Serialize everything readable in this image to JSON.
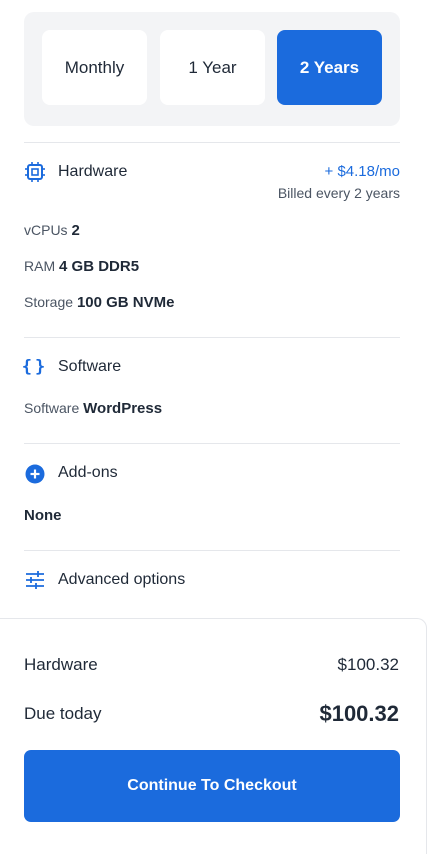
{
  "billing_period": {
    "options": [
      "Monthly",
      "1 Year",
      "2 Years"
    ],
    "selected": "2 Years"
  },
  "hardware": {
    "title": "Hardware",
    "price": "+ $4.18/mo",
    "billed": "Billed every 2 years",
    "specs": [
      {
        "label": "vCPUs",
        "value": "2"
      },
      {
        "label": "RAM",
        "value": "4 GB DDR5"
      },
      {
        "label": "Storage",
        "value": "100 GB NVMe"
      }
    ]
  },
  "software": {
    "title": "Software",
    "label": "Software",
    "value": "WordPress"
  },
  "addons": {
    "title": "Add-ons",
    "value": "None"
  },
  "advanced": {
    "title": "Advanced options"
  },
  "summary": {
    "hardware_label": "Hardware",
    "hardware_value": "$100.32",
    "due_label": "Due today",
    "due_value": "$100.32"
  },
  "checkout_label": "Continue To Checkout",
  "colors": {
    "accent": "#1b6bdd",
    "panel": "#f3f4f6"
  },
  "icons": [
    "chip-icon",
    "braces-icon",
    "plus-circle-icon",
    "sliders-icon"
  ]
}
